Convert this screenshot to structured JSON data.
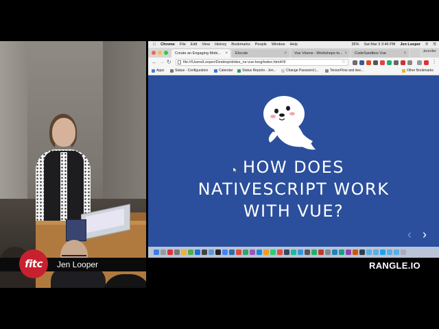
{
  "lower_third": {
    "logo": "fitc",
    "speaker": "Jen Looper",
    "sponsor": "RANGLE.IO"
  },
  "mac_menubar": {
    "items": [
      "Chrome",
      "File",
      "Edit",
      "View",
      "History",
      "Bookmarks",
      "People",
      "Window",
      "Help"
    ],
    "battery": "35%",
    "clock": "Sat Mar 3  3:46 PM",
    "user": "Jen Looper"
  },
  "browser": {
    "tabs": [
      {
        "label": "Create an Engaging Mobi...",
        "active": true
      },
      {
        "label": "Elocute",
        "active": false
      },
      {
        "label": "Vue Vixens - Workshops to...",
        "active": false
      },
      {
        "label": "CodeSandbox Vue",
        "active": false
      }
    ],
    "profile": "Jennifer",
    "url": "file:///Users/Looper/Desktop/slides_ns-vue-long/index.html#/9",
    "bookmarks": [
      "Apps",
      "Status - Configuration",
      "Calendar",
      "Status Reports - Jen...",
      "Change Password |...",
      "TensorFlow and dee...",
      "Other Bookmarks"
    ]
  },
  "slide": {
    "title_lines": [
      "HOW DOES",
      "NATIVESCRIPT WORK",
      "WITH VUE?"
    ],
    "prev": "‹",
    "next": "›",
    "background_color": "#2b4f9c"
  },
  "colors": {
    "fitc_red": "#c8202f",
    "slide_blue": "#2b4f9c"
  }
}
